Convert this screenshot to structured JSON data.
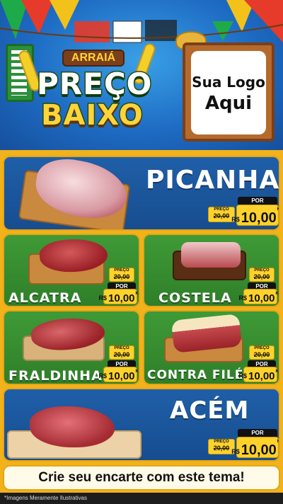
{
  "header": {
    "arraia_label": "ARRAIÁ",
    "title_line1": "PREÇO",
    "title_line2": "BAIXO",
    "logo_placeholder_line1": "Sua Logo",
    "logo_placeholder_line2": "Aqui"
  },
  "products": [
    {
      "name": "PICANHA",
      "old_label": "PREÇO",
      "old_price": "20,00",
      "por_label": "POR",
      "currency": "R$",
      "price": "10,00",
      "unit": "KG"
    },
    {
      "name": "ALCATRA",
      "old_label": "PREÇO",
      "old_price": "20,00",
      "por_label": "POR",
      "currency": "R$",
      "price": "10,00",
      "unit": "KG"
    },
    {
      "name": "COSTELA",
      "old_label": "PREÇO",
      "old_price": "20,00",
      "por_label": "POR",
      "currency": "R$",
      "price": "10,00",
      "unit": "KG"
    },
    {
      "name": "FRALDINHA",
      "old_label": "PREÇO",
      "old_price": "20,00",
      "por_label": "POR",
      "currency": "R$",
      "price": "10,00",
      "unit": "KG"
    },
    {
      "name": "CONTRA FILÉ",
      "old_label": "PREÇO",
      "old_price": "20,00",
      "por_label": "POR",
      "currency": "R$",
      "price": "10,00",
      "unit": "KG"
    },
    {
      "name": "ACÉM",
      "old_label": "PREÇO",
      "old_price": "20,00",
      "por_label": "POR",
      "currency": "R$",
      "price": "10,00",
      "unit": "KG"
    }
  ],
  "footer": {
    "cta": "Crie seu encarte com este tema!",
    "disclaimer": "*Imagens Meramente Ilustrativas"
  },
  "colors": {
    "background_yellow": "#f2b21b",
    "panel_blue": "#1f5fa8",
    "panel_green": "#3f9a36",
    "price_yellow": "#ffd22b"
  }
}
